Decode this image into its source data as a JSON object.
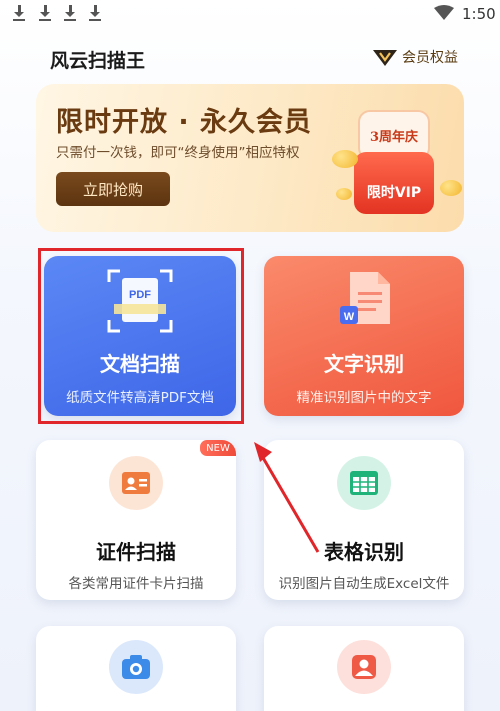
{
  "status_bar": {
    "time": "1:50",
    "icons": [
      "download-icon",
      "download-icon",
      "download-icon",
      "download-icon",
      "wifi-icon"
    ]
  },
  "header": {
    "app_title": "风云扫描王",
    "vip_link": "会员权益"
  },
  "banner": {
    "title": "限时开放 · 永久会员",
    "subtitle": "只需付一次钱，即可“终身使用”相应特权",
    "button": "立即抢购",
    "badge_top": "3周年庆",
    "badge_bottom": "限时VIP"
  },
  "tools": [
    {
      "title": "文档扫描",
      "subtitle": "纸质文件转高清PDF文档",
      "icon": "pdf-scan-icon",
      "icon_label": "PDF",
      "highlighted": true
    },
    {
      "title": "文字识别",
      "subtitle": "精准识别图片中的文字",
      "icon": "word-document-icon",
      "icon_label": "W"
    },
    {
      "title": "证件扫描",
      "subtitle": "各类常用证件卡片扫描",
      "icon": "id-card-icon",
      "badge": "NEW"
    },
    {
      "title": "表格识别",
      "subtitle": "识别图片自动生成Excel文件",
      "icon": "table-icon"
    },
    {
      "title": "",
      "subtitle": "",
      "icon": "camera-icon"
    },
    {
      "title": "",
      "subtitle": "",
      "icon": "portrait-icon"
    }
  ],
  "colors": {
    "accent_blue": "#3e66e8",
    "accent_orange": "#f0573e",
    "highlight_red": "#e0262a",
    "banner_brown": "#6a3a10"
  }
}
